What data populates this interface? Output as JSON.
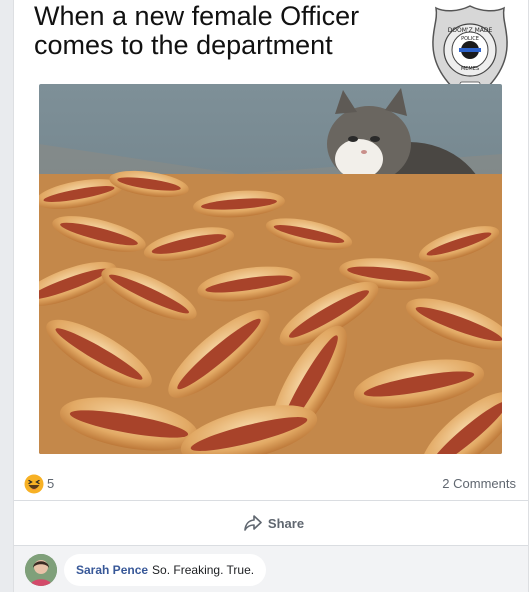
{
  "post": {
    "meme_caption": "When a new female Officer comes to the department",
    "badge": {
      "top_text": "DOOM'Z MADE",
      "middle_text": "POLICE",
      "bottom_text": "MEMES",
      "established": "EST. 2018"
    }
  },
  "reactions": {
    "icon": "haha-icon",
    "count": "5",
    "comments_label": "2 Comments"
  },
  "actions": {
    "share_label": "Share",
    "share_icon": "share-arrow-icon"
  },
  "comment": {
    "author": "Sarah Pence",
    "text": "So. Freaking. True."
  },
  "colors": {
    "link": "#385898",
    "secondary_text": "#606770",
    "haha_yellow": "#f7b125"
  }
}
